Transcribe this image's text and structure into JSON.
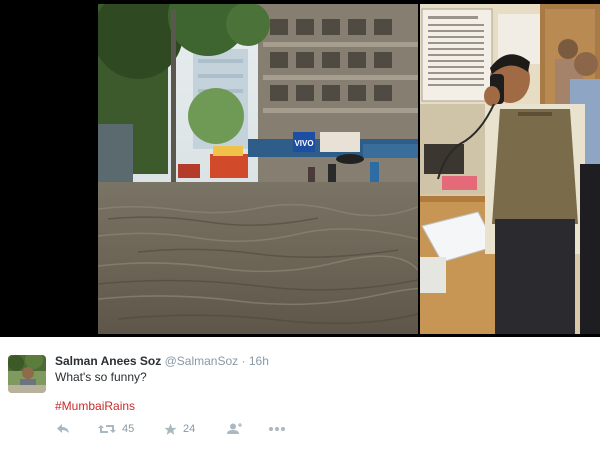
{
  "media": {
    "left_photo_icon": "flooded-street-photo",
    "right_photo_icon": "man-on-phone-photo",
    "sign_text": "VIVO"
  },
  "tweet": {
    "author_name": "Salman Anees Soz",
    "author_handle": "@SalmanSoz",
    "separator": "·",
    "timestamp": "16h",
    "text": "What's so funny?",
    "hashtag": "#MumbaiRains",
    "actions": {
      "reply_icon": "reply-icon",
      "retweet_icon": "retweet-icon",
      "retweet_count": "45",
      "favorite_icon": "star-icon",
      "favorite_count": "24",
      "follow_icon": "follow-icon",
      "more_icon": "more-icon"
    }
  },
  "colors": {
    "name": "#292f33",
    "meta": "#8899a6",
    "hashtag": "#cc2a2a",
    "background": "#ffffff"
  }
}
